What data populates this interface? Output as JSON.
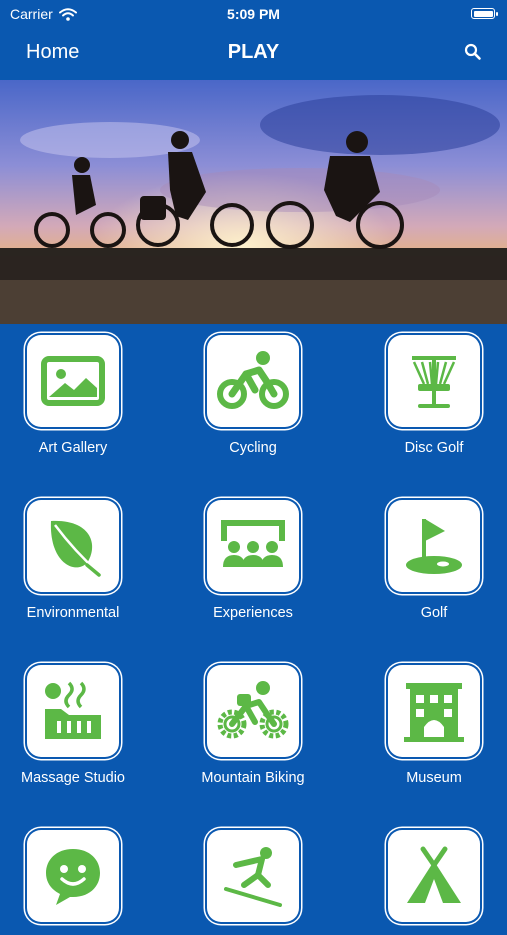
{
  "status": {
    "carrier": "Carrier",
    "time": "5:09 PM"
  },
  "nav": {
    "back_label": "Home",
    "title": "PLAY"
  },
  "colors": {
    "background": "#0a58b0",
    "icon_green": "#5cb846",
    "tile_bg": "#ffffff"
  },
  "tiles": [
    {
      "label": "Art Gallery",
      "icon": "image-icon"
    },
    {
      "label": "Cycling",
      "icon": "cycling-icon"
    },
    {
      "label": "Disc Golf",
      "icon": "disc-golf-basket-icon"
    },
    {
      "label": "Environmental",
      "icon": "leaf-icon"
    },
    {
      "label": "Experiences",
      "icon": "audience-icon"
    },
    {
      "label": "Golf",
      "icon": "golf-flag-icon"
    },
    {
      "label": "Massage Studio",
      "icon": "hot-stones-icon"
    },
    {
      "label": "Mountain Biking",
      "icon": "mountain-bike-icon"
    },
    {
      "label": "Museum",
      "icon": "museum-building-icon"
    },
    {
      "label": "",
      "icon": "smiley-chat-icon"
    },
    {
      "label": "",
      "icon": "skiing-icon"
    },
    {
      "label": "",
      "icon": "tent-icon"
    }
  ]
}
